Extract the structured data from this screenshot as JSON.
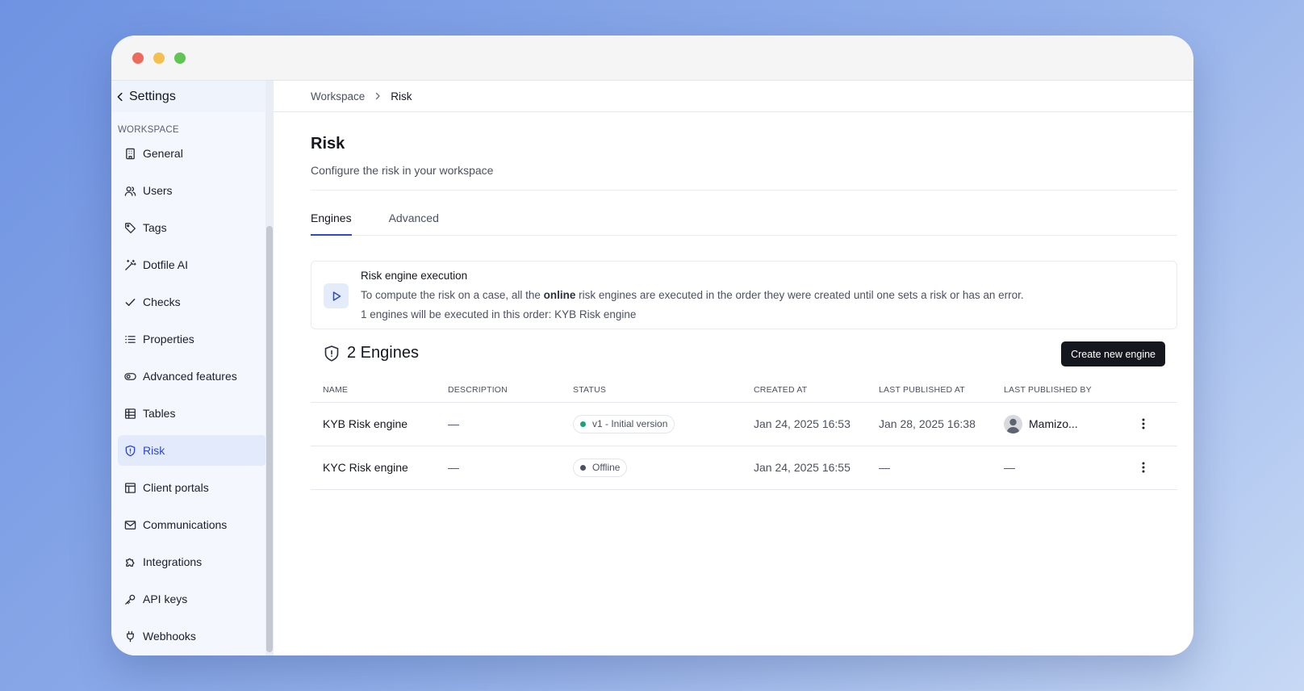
{
  "sidebar": {
    "title": "Settings",
    "section": "WORKSPACE",
    "items": [
      {
        "label": "General",
        "icon": "building-icon"
      },
      {
        "label": "Users",
        "icon": "users-icon"
      },
      {
        "label": "Tags",
        "icon": "tag-icon"
      },
      {
        "label": "Dotfile AI",
        "icon": "magic-wand-icon"
      },
      {
        "label": "Checks",
        "icon": "check-icon"
      },
      {
        "label": "Properties",
        "icon": "list-icon"
      },
      {
        "label": "Advanced features",
        "icon": "toggle-icon"
      },
      {
        "label": "Tables",
        "icon": "table-icon"
      },
      {
        "label": "Risk",
        "icon": "shield-icon",
        "active": true
      },
      {
        "label": "Client portals",
        "icon": "layout-icon"
      },
      {
        "label": "Communications",
        "icon": "mail-icon"
      },
      {
        "label": "Integrations",
        "icon": "puzzle-icon"
      },
      {
        "label": "API keys",
        "icon": "key-icon"
      },
      {
        "label": "Webhooks",
        "icon": "plug-icon"
      }
    ]
  },
  "breadcrumb": {
    "parent": "Workspace",
    "current": "Risk"
  },
  "page": {
    "title": "Risk",
    "subtitle": "Configure the risk in your workspace"
  },
  "tabs": [
    {
      "label": "Engines",
      "active": true
    },
    {
      "label": "Advanced",
      "active": false
    }
  ],
  "info": {
    "title": "Risk engine execution",
    "line1_before": "To compute the risk on a case, all the ",
    "line1_strong": "online",
    "line1_after": " risk engines are executed in the order they were created until one sets a risk or has an error.",
    "line2": "1 engines will be executed in this order: KYB Risk engine"
  },
  "engines": {
    "title": "2 Engines",
    "create_label": "Create new engine",
    "columns": [
      "NAME",
      "DESCRIPTION",
      "STATUS",
      "CREATED AT",
      "LAST PUBLISHED AT",
      "LAST PUBLISHED BY"
    ],
    "rows": [
      {
        "name": "KYB Risk engine",
        "description": "—",
        "status": "v1 - Initial version",
        "status_color": "#1aa37a",
        "created_at": "Jan 24, 2025 16:53",
        "last_published_at": "Jan 28, 2025 16:38",
        "last_published_by": "Mamizo..."
      },
      {
        "name": "KYC Risk engine",
        "description": "—",
        "status": "Offline",
        "status_color": "#4b5161",
        "created_at": "Jan 24, 2025 16:55",
        "last_published_at": "—",
        "last_published_by": "—"
      }
    ]
  },
  "colors": {
    "accent": "#2d48c8",
    "active_bg": "#e3eafb",
    "online_dot": "#1aa37a",
    "offline_dot": "#4b5161"
  }
}
